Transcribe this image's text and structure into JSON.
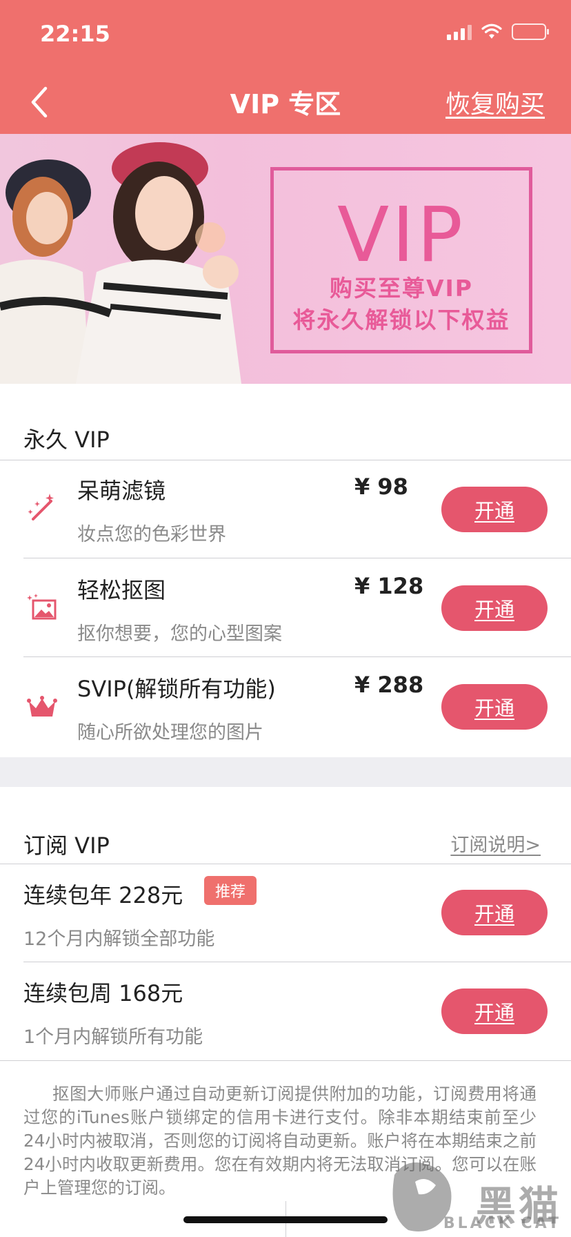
{
  "status_bar": {
    "time": "22:15"
  },
  "nav": {
    "title": "VIP 专区",
    "restore_label": "恢复购买"
  },
  "banner": {
    "vip_text": "VIP",
    "line1": "购买至尊VIP",
    "line2": "将永久解锁以下权益"
  },
  "permanent": {
    "title": "永久 VIP",
    "items": [
      {
        "icon": "magic-wand-icon",
        "title": "呆萌滤镜",
        "desc": "妆点您的色彩世界",
        "price": "¥ 98",
        "button": "开通"
      },
      {
        "icon": "image-cutout-icon",
        "title": "轻松抠图",
        "desc": "抠你想要，您的心型图案",
        "price": "¥ 128",
        "button": "开通"
      },
      {
        "icon": "crown-icon",
        "title": "SVIP(解锁所有功能)",
        "desc": "随心所欲处理您的图片",
        "price": "¥ 288",
        "button": "开通"
      }
    ]
  },
  "subscription": {
    "title": "订阅 VIP",
    "info_link": "订阅说明>",
    "items": [
      {
        "title": "连续包年 228元",
        "badge": "推荐",
        "desc": "12个月内解锁全部功能",
        "button": "开通"
      },
      {
        "title": "连续包周 168元",
        "desc": "1个月内解锁所有功能",
        "button": "开通"
      }
    ]
  },
  "legal_text": "抠图大师账户通过自动更新订阅提供附加的功能，订阅费用将通过您的iTunes账户锁绑定的信用卡进行支付。除非本期结束前至少24小时内被取消，否则您的订阅将自动更新。账户将在本期结束之前24小时内收取更新费用。您在有效期内将无法取消订阅。您可以在账户上管理您的订阅。",
  "watermark": {
    "text": "黑猫",
    "sub": "BLACK CAT"
  },
  "colors": {
    "header": "#ef706d",
    "button": "#e5566d",
    "banner_accent": "#e85a98"
  }
}
